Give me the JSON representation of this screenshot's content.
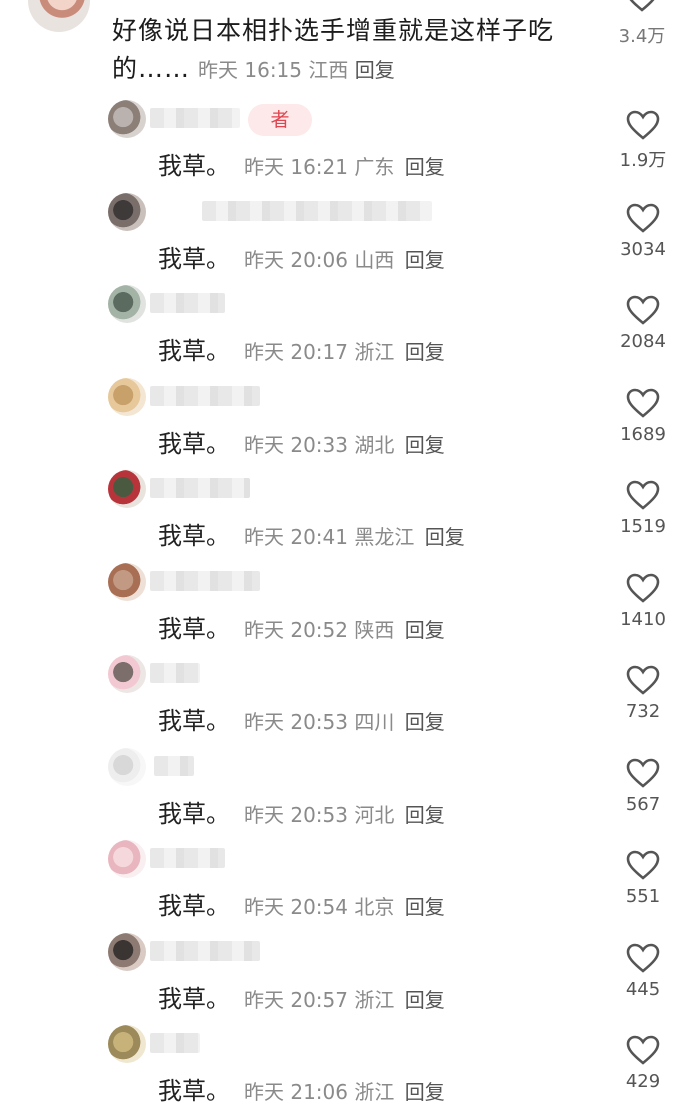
{
  "parent": {
    "text": "好像说日本相扑选手增重就是这样子吃的……",
    "time": "昨天 16:15",
    "location": "江西",
    "reply_label": "回复",
    "likes": "3.4万"
  },
  "author_tag": "者",
  "replies": [
    {
      "text": "我草。",
      "time": "昨天 16:21",
      "location": "广东",
      "reply_label": "回复",
      "likes": "1.9万"
    },
    {
      "text": "我草。",
      "time": "昨天 20:06",
      "location": "山西",
      "reply_label": "回复",
      "likes": "3034"
    },
    {
      "text": "我草。",
      "time": "昨天 20:17",
      "location": "浙江",
      "reply_label": "回复",
      "likes": "2084"
    },
    {
      "text": "我草。",
      "time": "昨天 20:33",
      "location": "湖北",
      "reply_label": "回复",
      "likes": "1689"
    },
    {
      "text": "我草。",
      "time": "昨天 20:41",
      "location": "黑龙江",
      "reply_label": "回复",
      "likes": "1519"
    },
    {
      "text": "我草。",
      "time": "昨天 20:52",
      "location": "陕西",
      "reply_label": "回复",
      "likes": "1410"
    },
    {
      "text": "我草。",
      "time": "昨天 20:53",
      "location": "四川",
      "reply_label": "回复",
      "likes": "732"
    },
    {
      "text": "我草。",
      "time": "昨天 20:53",
      "location": "河北",
      "reply_label": "回复",
      "likes": "567"
    },
    {
      "text": "我草。",
      "time": "昨天 20:54",
      "location": "北京",
      "reply_label": "回复",
      "likes": "551"
    },
    {
      "text": "我草。",
      "time": "昨天 20:57",
      "location": "浙江",
      "reply_label": "回复",
      "likes": "445"
    },
    {
      "text": "我草。",
      "time": "昨天 21:06",
      "location": "浙江",
      "reply_label": "回复",
      "likes": "429"
    }
  ],
  "icons": {
    "like": "heart-outline-icon"
  },
  "colors": {
    "author_tag_bg": "#fde8ea",
    "author_tag_text": "#e0454f",
    "meta": "#8a8a8a"
  }
}
